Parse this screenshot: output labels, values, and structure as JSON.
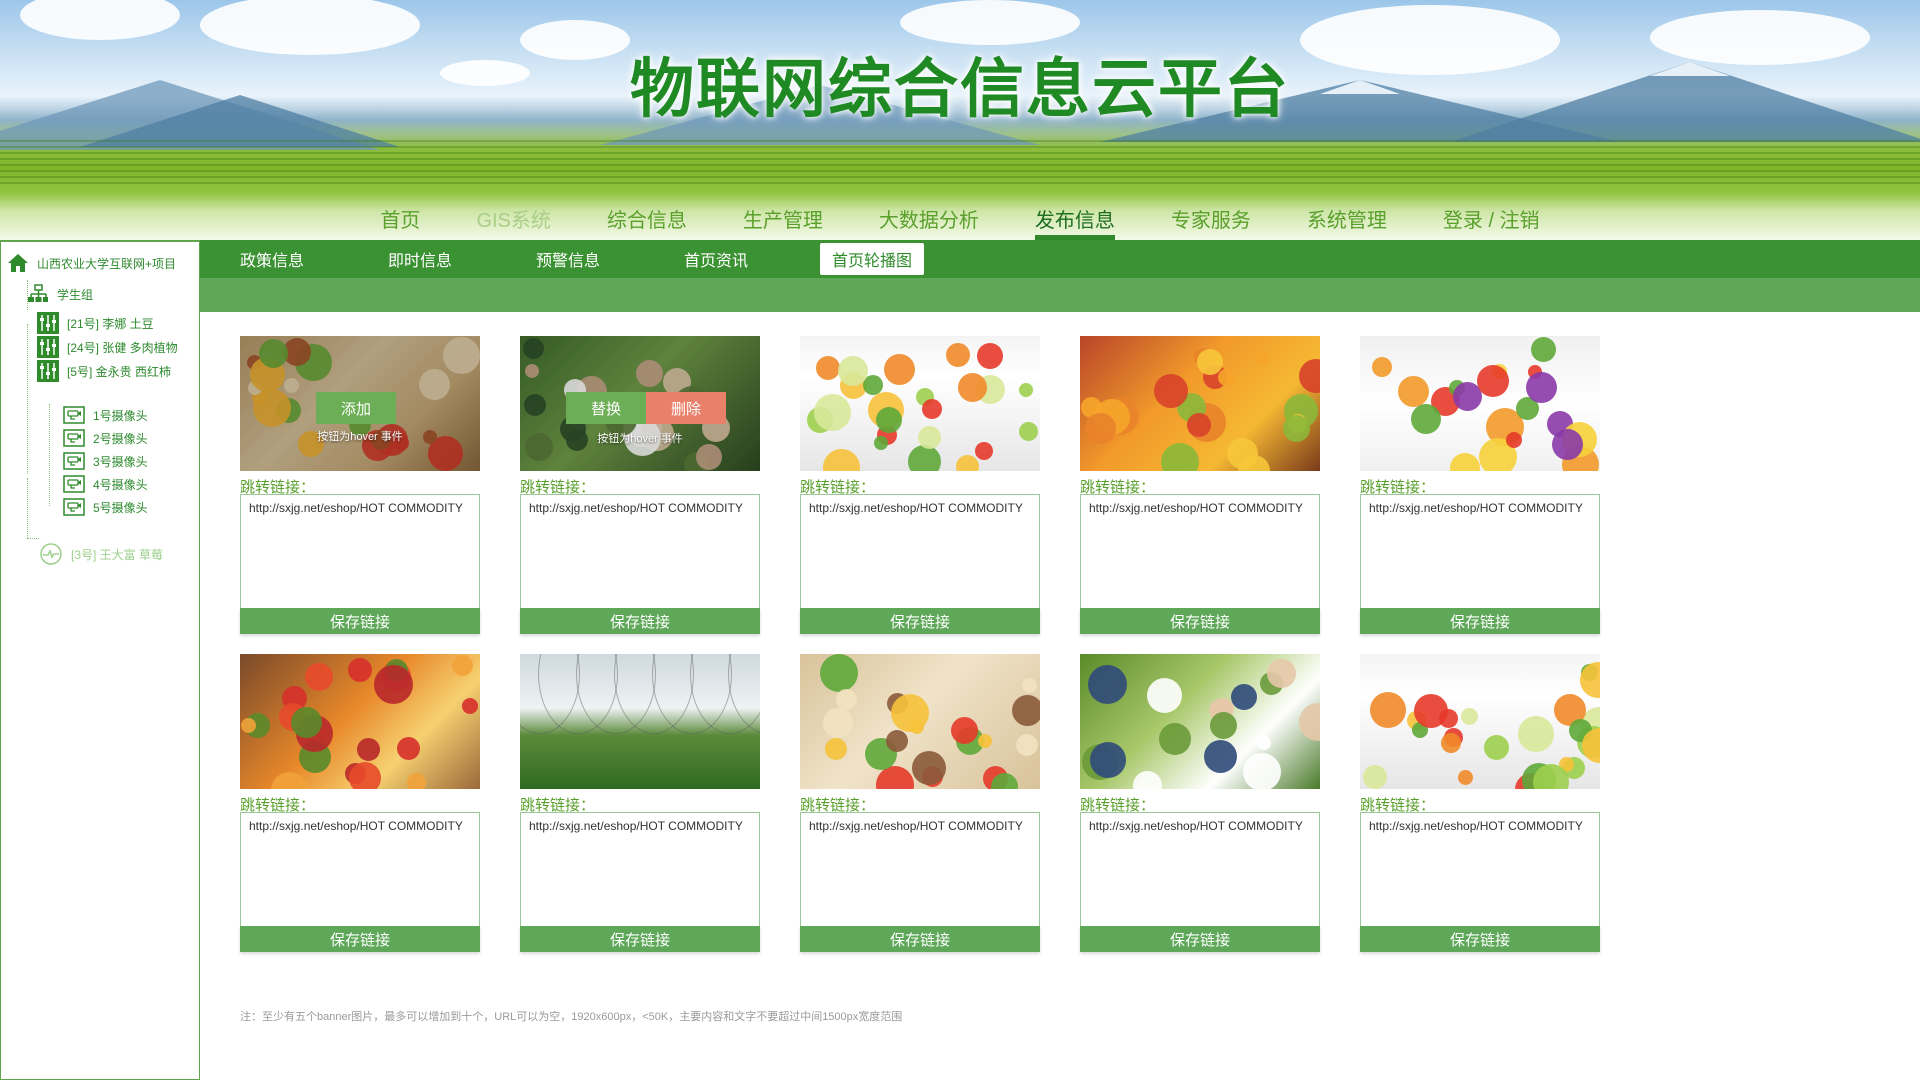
{
  "header": {
    "title": "物联网综合信息云平台",
    "nav": [
      {
        "label": "首页",
        "state": "normal"
      },
      {
        "label": "GIS系统",
        "state": "muted"
      },
      {
        "label": "综合信息",
        "state": "normal"
      },
      {
        "label": "生产管理",
        "state": "normal"
      },
      {
        "label": "大数据分析",
        "state": "normal"
      },
      {
        "label": "发布信息",
        "state": "active"
      },
      {
        "label": "专家服务",
        "state": "normal"
      },
      {
        "label": "系统管理",
        "state": "normal"
      },
      {
        "label": "登录 / 注销",
        "state": "normal"
      }
    ]
  },
  "sidebar": {
    "root": "山西农业大学互联网+项目",
    "group": "学生组",
    "projects": [
      {
        "label": "[21号] 李娜 土豆"
      },
      {
        "label": "[24号] 张健 多肉植物"
      },
      {
        "label": "[5号] 金永贵 西红柿"
      }
    ],
    "cameras": [
      "1号摄像头",
      "2号摄像头",
      "3号摄像头",
      "4号摄像头",
      "5号摄像头"
    ],
    "inactive_project": "[3号] 王大富 草莓"
  },
  "subnav": {
    "items": [
      "政策信息",
      "即时信息",
      "预警信息",
      "首页资讯",
      "首页轮播图"
    ],
    "active_index": 4
  },
  "cards": {
    "label": "跳转链接：",
    "url": "http://sxjg.net/eshop/HOT COMMODITY",
    "save": "保存链接",
    "add_button": "添加",
    "replace_button": "替换",
    "delete_button": "删除",
    "hover_note": "按钮为hover 事件",
    "count": 10
  },
  "footnote": "注：至少有五个banner图片，最多可以增加到十个，URL可以为空，1920x600px，<50K，主要内容和文字不要超过中间1500px宽度范围",
  "colors": {
    "primary_green": "#3b9232",
    "light_green": "#5fa85a",
    "title_green": "#1f8a23",
    "delete_red": "#e9806a"
  }
}
